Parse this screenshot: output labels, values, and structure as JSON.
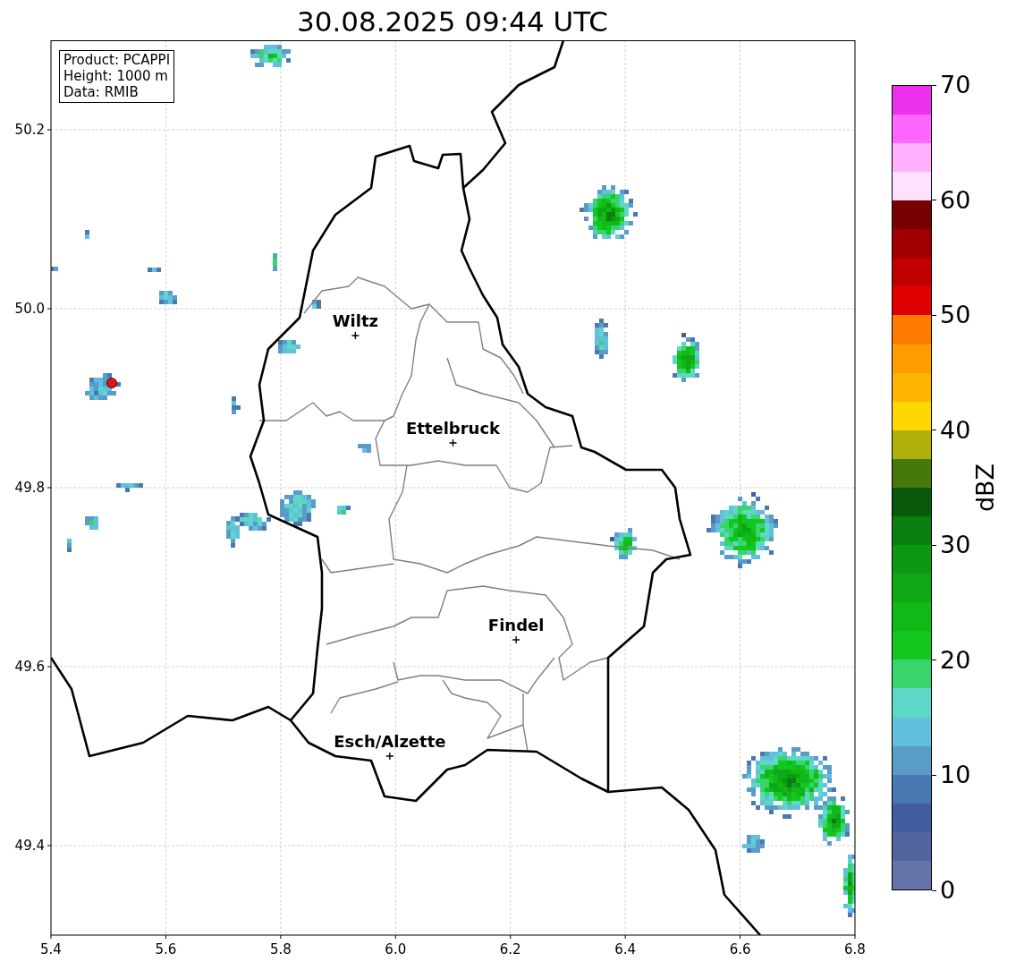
{
  "title": "30.08.2025 09:44 UTC",
  "info_box": [
    "Product: PCAPPI",
    "Height: 1000 m",
    "Data: RMIB"
  ],
  "map": {
    "chart_data": {
      "type": "scatter",
      "x": [
        5.93,
        6.1,
        6.21,
        5.99
      ],
      "series": [
        {
          "color": "#000000",
          "values": [
            49.97,
            49.85,
            49.63,
            49.5
          ]
        }
      ],
      "grid": true,
      "xlim": [
        5.4,
        6.8
      ],
      "ylim": [
        49.3,
        50.3
      ],
      "xticks": [
        {
          "value": 5.4,
          "label": "5.4"
        },
        {
          "value": 5.6,
          "label": "5.6"
        },
        {
          "value": 5.8,
          "label": "5.8"
        },
        {
          "value": 6.0,
          "label": "6.0"
        },
        {
          "value": 6.2,
          "label": "6.2"
        },
        {
          "value": 6.4,
          "label": "6.4"
        },
        {
          "value": 6.6,
          "label": "6.6"
        },
        {
          "value": 6.8,
          "label": "6.8"
        }
      ],
      "yticks": [
        {
          "value": 49.4,
          "label": "49.4"
        },
        {
          "value": 49.6,
          "label": "49.6"
        },
        {
          "value": 49.8,
          "label": "49.8"
        },
        {
          "value": 50.0,
          "label": "50.0"
        },
        {
          "value": 50.2,
          "label": "50.2"
        }
      ],
      "annotations": [
        {
          "x": 5.93,
          "y": 49.97,
          "text": "Wiltz"
        },
        {
          "x": 6.1,
          "y": 49.85,
          "text": "Ettelbruck"
        },
        {
          "x": 6.21,
          "y": 49.63,
          "text": "Findel"
        },
        {
          "x": 5.99,
          "y": 49.5,
          "text": "Esch/Alzette"
        }
      ]
    }
  },
  "colorbar": {
    "label": "dBZ",
    "ticks": [
      "70",
      "60",
      "50",
      "40",
      "30",
      "20",
      "10",
      "0"
    ],
    "bins": [
      {
        "color": "#6573a8"
      },
      {
        "color": "#50659e"
      },
      {
        "color": "#425ca0"
      },
      {
        "color": "#4a78b0"
      },
      {
        "color": "#5a9cc8"
      },
      {
        "color": "#62c0dc"
      },
      {
        "color": "#5dd8c6"
      },
      {
        "color": "#3ad46e"
      },
      {
        "color": "#12c81e"
      },
      {
        "color": "#10b818"
      },
      {
        "color": "#0ea814"
      },
      {
        "color": "#0c9812"
      },
      {
        "color": "#0a7e10"
      },
      {
        "color": "#085a0a"
      },
      {
        "color": "#46780a"
      },
      {
        "color": "#b0b00a"
      },
      {
        "color": "#ffd800"
      },
      {
        "color": "#ffb400"
      },
      {
        "color": "#ff9c00"
      },
      {
        "color": "#ff7c00"
      },
      {
        "color": "#e00000"
      },
      {
        "color": "#c00000"
      },
      {
        "color": "#a00000"
      },
      {
        "color": "#780000"
      },
      {
        "color": "#ffe0ff"
      },
      {
        "color": "#ffb0ff"
      },
      {
        "color": "#ff66ff"
      },
      {
        "color": "#ec30ec"
      }
    ]
  }
}
